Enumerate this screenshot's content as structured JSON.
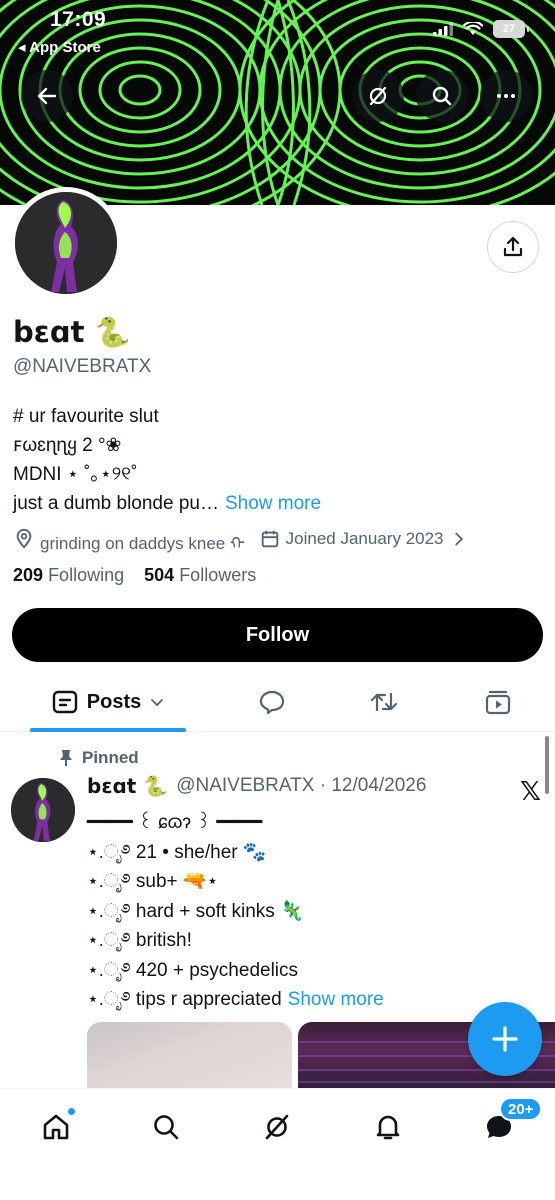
{
  "status_bar": {
    "time": "17:09",
    "back_app": "◂ App Store",
    "battery": "27"
  },
  "profile": {
    "display_name": "bɛɑt 🐍",
    "handle": "@NAIVEBRATX",
    "bio_lines": [
      "# ur favourite slut",
      "ꜰωɛɳɳყ 2 °❀",
      "MDNI ⋆ ˚｡⋆୨୧˚"
    ],
    "bio_last_line": "just a dumb blonde pu…",
    "show_more": "Show more",
    "location": "grinding on daddys knee ᡣ",
    "joined": "Joined January 2023",
    "following_count": "209",
    "following_label": "Following",
    "followers_count": "504",
    "followers_label": "Followers",
    "follow_button": "Follow"
  },
  "tabs": {
    "posts_label": "Posts"
  },
  "pinned_post": {
    "pinned_label": "Pinned",
    "name": "bɛɑt 🐍",
    "handle": "@NAIVEBRATX",
    "date": "12/04/2026",
    "lines": [
      "━━━━ ꒰ ɕɷɂ ꒱ ━━━━",
      "⋆.ೃ࿔ 21 • she/her 🐾",
      "⋆.ೃ࿔ sub+ 🔫⋆",
      "⋆.ೃ࿔ hard + soft kinks 🦎",
      "⋆.ೃ࿔ british!",
      "⋆.ೃ࿔ 420 + psychedelics"
    ],
    "last_line": "⋆.ೃ࿔ tips r appreciated",
    "show_more": "Show more"
  },
  "bottom_nav": {
    "messages_badge": "20+"
  },
  "colors": {
    "accent": "#1d9bf0",
    "text": "#0f1419",
    "secondary": "#536471",
    "banner_lines": "#6cff5a"
  },
  "icons": [
    "back-arrow-icon",
    "grok-icon",
    "search-icon",
    "more-icon",
    "share-icon",
    "location-icon",
    "calendar-icon",
    "chevron-right-icon",
    "posts-icon",
    "replies-icon",
    "reposts-icon",
    "media-icon",
    "pin-icon",
    "x-logo-icon",
    "compose-icon",
    "home-icon",
    "bell-icon",
    "messages-icon"
  ]
}
